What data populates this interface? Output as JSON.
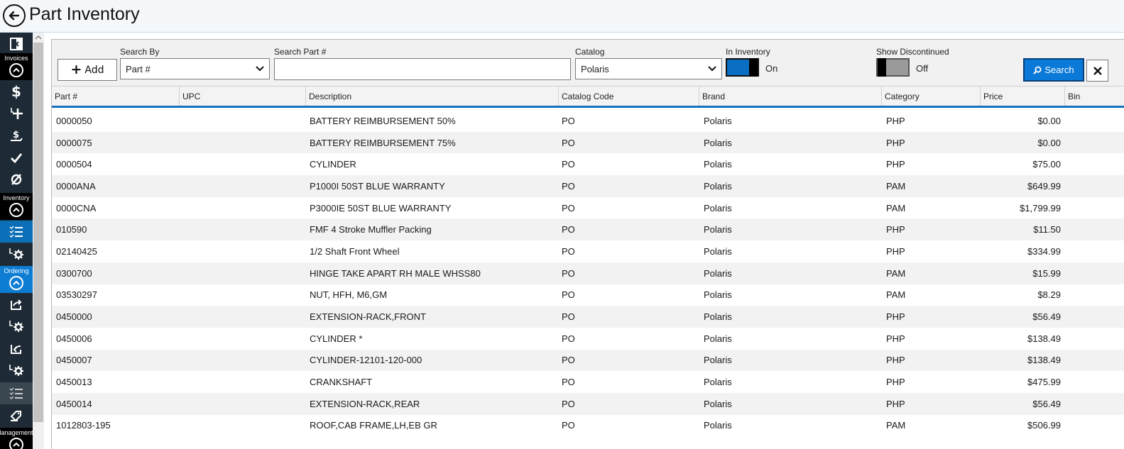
{
  "window": {
    "title": "Part Inventory"
  },
  "sidebar": {
    "sections": [
      {
        "label": "Invoices"
      },
      {
        "label": "Inventory"
      },
      {
        "label": "Ordering"
      },
      {
        "label": "Management"
      }
    ]
  },
  "toolbar": {
    "add_label": "Add",
    "search_by_label": "Search By",
    "search_by_value": "Part #",
    "search_part_label": "Search Part #",
    "search_part_value": "",
    "catalog_label": "Catalog",
    "catalog_value": "Polaris",
    "in_inventory_label": "In Inventory",
    "in_inventory_state": "On",
    "show_discontinued_label": "Show Discontinued",
    "show_discontinued_state": "Off",
    "search_label": "Search"
  },
  "table": {
    "columns": [
      "Part #",
      "UPC",
      "Description",
      "Catalog Code",
      "Brand",
      "Category",
      "Price",
      "Bin"
    ],
    "rows": [
      [
        "0000050",
        "",
        "BATTERY REIMBURSEMENT 50%",
        "PO",
        "Polaris",
        "PHP",
        "$0.00",
        ""
      ],
      [
        "0000075",
        "",
        "BATTERY REIMBURSEMENT 75%",
        "PO",
        "Polaris",
        "PHP",
        "$0.00",
        ""
      ],
      [
        "0000504",
        "",
        "CYLINDER",
        "PO",
        "Polaris",
        "PHP",
        "$75.00",
        ""
      ],
      [
        "0000ANA",
        "",
        "P1000I 50ST BLUE WARRANTY",
        "PO",
        "Polaris",
        "PAM",
        "$649.99",
        ""
      ],
      [
        "0000CNA",
        "",
        "P3000IE 50ST BLUE WARRANTY",
        "PO",
        "Polaris",
        "PAM",
        "$1,799.99",
        ""
      ],
      [
        "010590",
        "",
        "FMF 4 Stroke Muffler Packing",
        "PO",
        "Polaris",
        "PHP",
        "$11.50",
        ""
      ],
      [
        "02140425",
        "",
        "1/2 Shaft Front Wheel",
        "PO",
        "Polaris",
        "PHP",
        "$334.99",
        ""
      ],
      [
        "0300700",
        "",
        "HINGE TAKE APART RH MALE WHSS80",
        "PO",
        "Polaris",
        "PAM",
        "$15.99",
        ""
      ],
      [
        "03530297",
        "",
        "NUT, HFH, M6,GM",
        "PO",
        "Polaris",
        "PAM",
        "$8.29",
        ""
      ],
      [
        "0450000",
        "",
        "EXTENSION-RACK,FRONT",
        "PO",
        "Polaris",
        "PHP",
        "$56.49",
        ""
      ],
      [
        "0450006",
        "",
        "CYLINDER *",
        "PO",
        "Polaris",
        "PHP",
        "$138.49",
        ""
      ],
      [
        "0450007",
        "",
        "CYLINDER-12101-120-000",
        "PO",
        "Polaris",
        "PHP",
        "$138.49",
        ""
      ],
      [
        "0450013",
        "",
        "CRANKSHAFT",
        "PO",
        "Polaris",
        "PHP",
        "$475.99",
        ""
      ],
      [
        "0450014",
        "",
        "EXTENSION-RACK,REAR",
        "PO",
        "Polaris",
        "PHP",
        "$56.49",
        ""
      ],
      [
        "1012803-195",
        "",
        "ROOF,CAB FRAME,LH,EB GR",
        "PO",
        "Polaris",
        "PAM",
        "$506.99",
        ""
      ]
    ]
  },
  "colors": {
    "accent": "#0a79d8",
    "sidebar": "#1e2b36",
    "active_item": "#0b6fb8"
  }
}
